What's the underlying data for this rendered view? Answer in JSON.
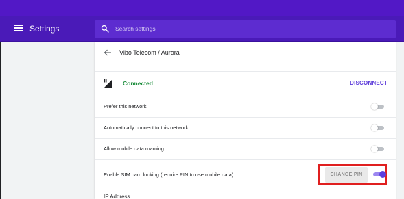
{
  "header": {
    "title": "Settings",
    "menu_icon": "hamburger-menu-icon",
    "search": {
      "placeholder": "Search settings",
      "value": "",
      "icon": "search-icon"
    }
  },
  "subpage": {
    "back_icon": "arrow-back-icon",
    "title": "Vibo Telecom / Aurora"
  },
  "network_status": {
    "signal_icon": "cellular-signal-icon",
    "status": "Connected",
    "action_label": "DISCONNECT"
  },
  "settings": [
    {
      "label": "Prefer this network",
      "enabled": false
    },
    {
      "label": "Automatically connect to this network",
      "enabled": false
    },
    {
      "label": "Allow mobile data roaming",
      "enabled": false
    },
    {
      "label": "Enable SIM card locking (require PIN to use mobile data)",
      "enabled": true,
      "button_label": "CHANGE PIN"
    }
  ],
  "ip_section": {
    "label": "IP Address"
  },
  "colors": {
    "header": "#4a1ab8",
    "accent": "#5b3ee0",
    "connected": "#1e8e3e",
    "highlight": "#e01f1f"
  }
}
